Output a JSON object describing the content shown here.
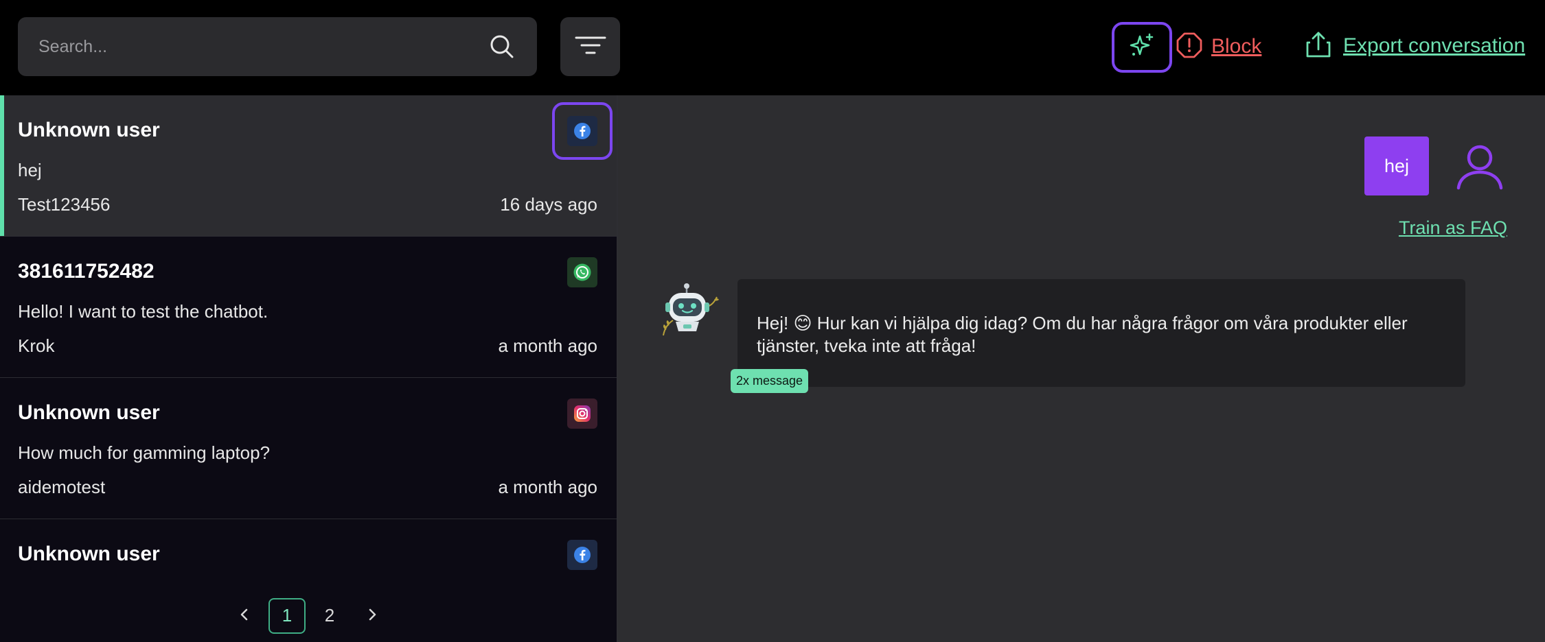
{
  "search": {
    "placeholder": "Search..."
  },
  "toolbar": {
    "block_label": "Block",
    "export_label": "Export conversation"
  },
  "colors": {
    "accent_purple": "#7c46f0",
    "accent_green": "#5fe0ab",
    "danger_red": "#f05d5d",
    "user_bubble": "#8e3ff0"
  },
  "conversations": [
    {
      "name": "Unknown user",
      "message": "hej",
      "user": "Test123456",
      "time": "16 days ago",
      "channel": "facebook-icon",
      "active": true
    },
    {
      "name": "381611752482",
      "message": "Hello! I want to test the chatbot.",
      "user": "Krok",
      "time": "a month ago",
      "channel": "whatsapp-icon",
      "active": false
    },
    {
      "name": "Unknown user",
      "message": "How much for gamming laptop?",
      "user": "aidemotest",
      "time": "a month ago",
      "channel": "instagram-icon",
      "active": false
    },
    {
      "name": "Unknown user",
      "message": "",
      "user": "",
      "time": "",
      "channel": "facebook-icon",
      "active": false
    }
  ],
  "pagination": {
    "pages": [
      "1",
      "2"
    ],
    "current": "1"
  },
  "chat": {
    "user_message": "hej",
    "train_faq_label": "Train as FAQ",
    "bot_message": "Hej! 😊 Hur kan vi hjälpa dig idag? Om du har några frågor om våra produkter eller tjänster, tveka inte att fråga!",
    "message_count_badge": "2x message"
  }
}
